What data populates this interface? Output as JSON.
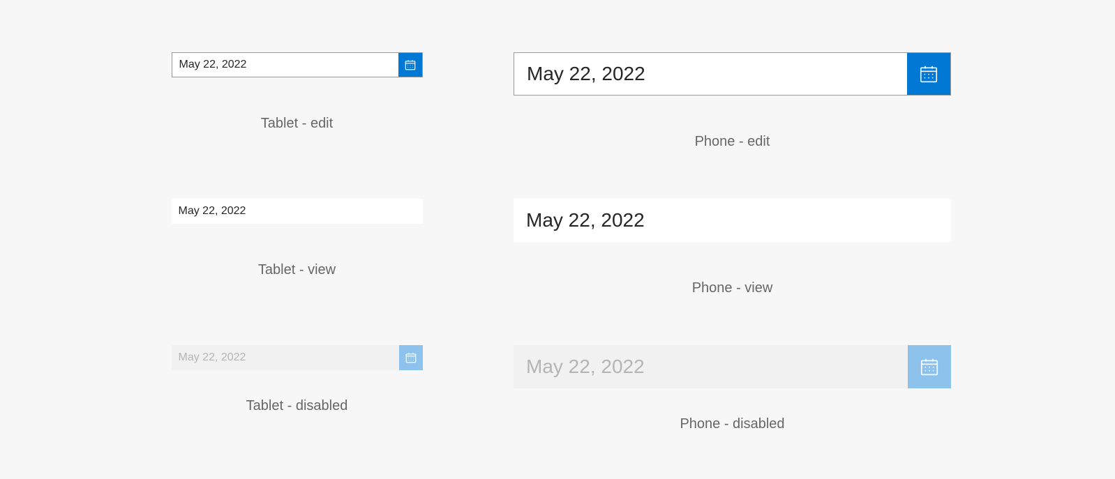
{
  "date_value": "May 22, 2022",
  "captions": {
    "tablet_edit": "Tablet - edit",
    "phone_edit": "Phone - edit",
    "tablet_view": "Tablet - view",
    "phone_view": "Phone - view",
    "tablet_disabled": "Tablet - disabled",
    "phone_disabled": "Phone - disabled"
  },
  "colors": {
    "accent": "#0078d4",
    "disabled_accent": "#8cc2ec",
    "text": "#262626",
    "disabled_text": "#b5b5b5",
    "caption": "#666666",
    "page_bg": "#f7f7f7"
  }
}
